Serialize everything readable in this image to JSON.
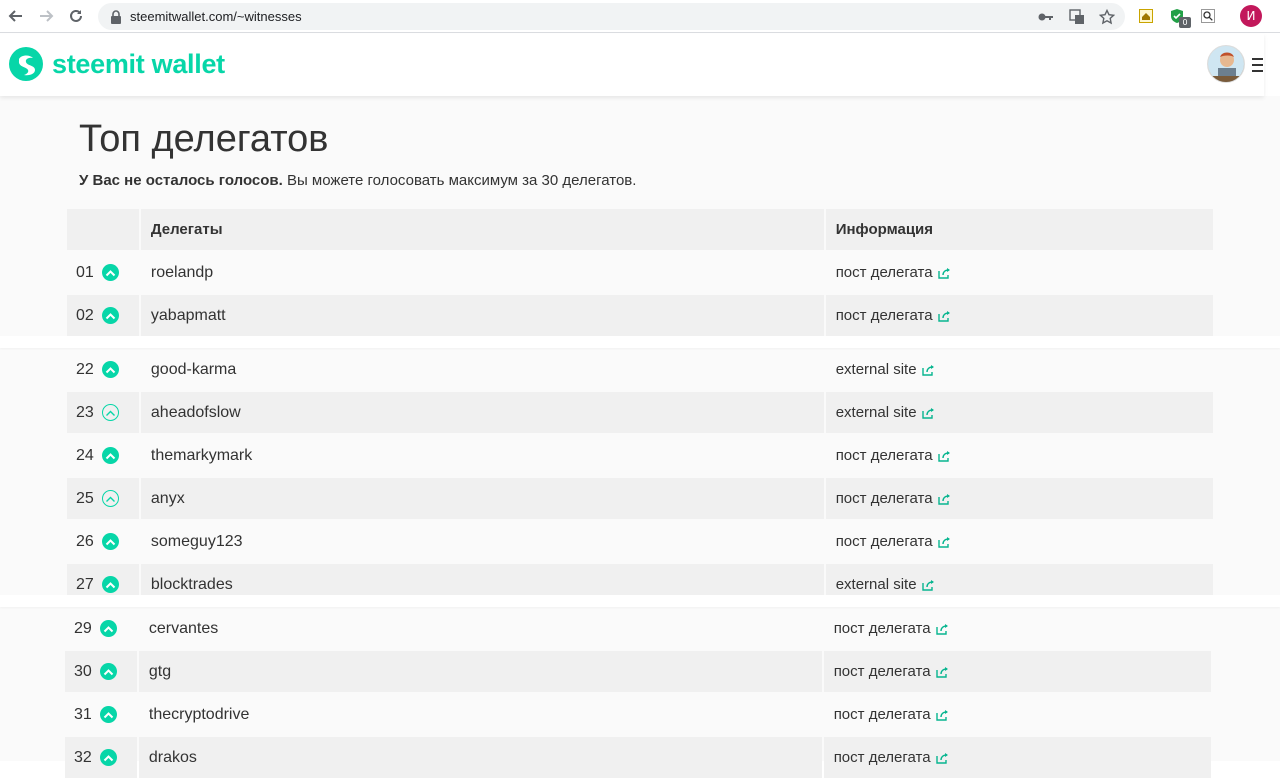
{
  "browser": {
    "url": "steemitwallet.com/~witnesses",
    "profile_initial": "И",
    "extension_badge": "0"
  },
  "brand": {
    "name": "steemit wallet",
    "color": "#07d6a8"
  },
  "page": {
    "title": "Топ делегатов",
    "notice_bold": "У Вас не осталось голосов.",
    "notice_rest": " Вы можете голосовать максимум за 30 делегатов."
  },
  "table": {
    "headers": {
      "witnesses": "Делегаты",
      "info": "Информация"
    },
    "rows": [
      {
        "rank": "01",
        "name": "roelandp",
        "info": "пост делегата",
        "voted": true
      },
      {
        "rank": "02",
        "name": "yabapmatt",
        "info": "пост делегата",
        "voted": true
      },
      {
        "rank": "22",
        "name": "good-karma",
        "info": "external site",
        "voted": true
      },
      {
        "rank": "23",
        "name": "aheadofslow",
        "info": "external site",
        "voted": false
      },
      {
        "rank": "24",
        "name": "themarkymark",
        "info": "пост делегата",
        "voted": true
      },
      {
        "rank": "25",
        "name": "anyx",
        "info": "пост делегата",
        "voted": false
      },
      {
        "rank": "26",
        "name": "someguy123",
        "info": "пост делегата",
        "voted": true
      },
      {
        "rank": "27",
        "name": "blocktrades",
        "info": "external site",
        "voted": true
      },
      {
        "rank": "29",
        "name": "cervantes",
        "info": "пост делегата",
        "voted": true
      },
      {
        "rank": "30",
        "name": "gtg",
        "info": "пост делегата",
        "voted": true
      },
      {
        "rank": "31",
        "name": "thecryptodrive",
        "info": "пост делегата",
        "voted": true
      },
      {
        "rank": "32",
        "name": "drakos",
        "info": "пост делегата",
        "voted": true
      }
    ]
  }
}
